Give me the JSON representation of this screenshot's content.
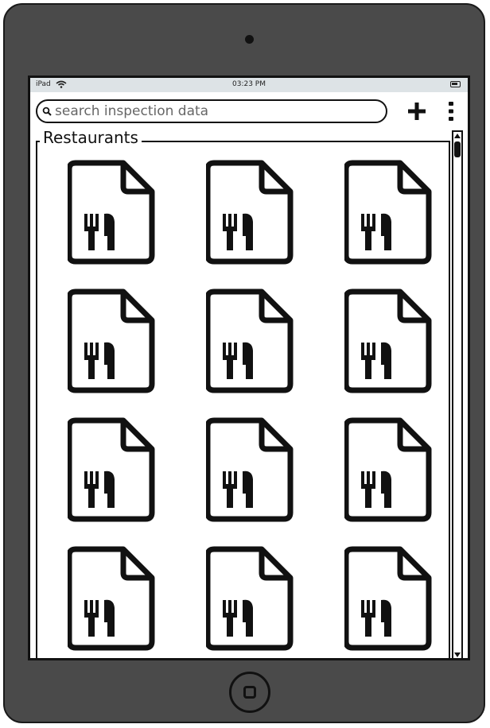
{
  "device": "iPad",
  "status": {
    "device_label": "iPad",
    "time": "03:23 PM",
    "icons": [
      "wifi-icon",
      "battery-icon"
    ]
  },
  "search": {
    "placeholder": "search inspection data",
    "value": "",
    "icon": "search-icon"
  },
  "toolbar": {
    "add_icon": "plus-icon",
    "menu_icon": "vertical-dots-icon"
  },
  "panel": {
    "title": "Restaurants"
  },
  "restaurants": {
    "columns": 3,
    "visible_rows": 4,
    "item_icon": "restaurant-document-icon",
    "items": [
      {
        "icon": "restaurant-document-icon"
      },
      {
        "icon": "restaurant-document-icon"
      },
      {
        "icon": "restaurant-document-icon"
      },
      {
        "icon": "restaurant-document-icon"
      },
      {
        "icon": "restaurant-document-icon"
      },
      {
        "icon": "restaurant-document-icon"
      },
      {
        "icon": "restaurant-document-icon"
      },
      {
        "icon": "restaurant-document-icon"
      },
      {
        "icon": "restaurant-document-icon"
      },
      {
        "icon": "restaurant-document-icon"
      },
      {
        "icon": "restaurant-document-icon"
      },
      {
        "icon": "restaurant-document-icon"
      }
    ]
  },
  "colors": {
    "device_frame": "#4a4a4a",
    "status_bar": "#dde3e6",
    "ink": "#111111",
    "placeholder": "#666666"
  }
}
